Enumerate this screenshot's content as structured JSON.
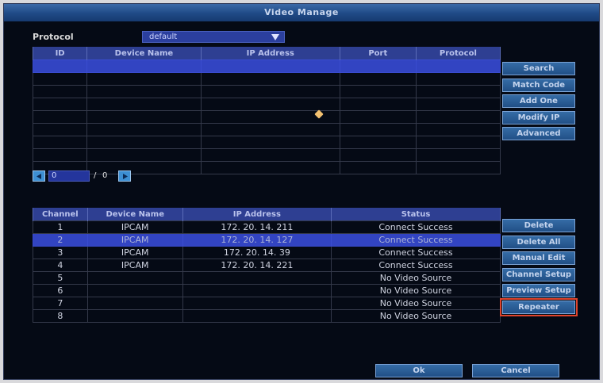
{
  "window": {
    "title": "Video Manage"
  },
  "protocol": {
    "label": "Protocol",
    "value": "default"
  },
  "device_table": {
    "headers": [
      "ID",
      "Device Name",
      "IP Address",
      "Port",
      "Protocol"
    ],
    "row_count": 9,
    "selected_row": 0
  },
  "side_buttons_top": [
    "Search",
    "Match Code",
    "Add One",
    "Modify IP",
    "Advanced"
  ],
  "pager": {
    "current": "0",
    "separator": "/",
    "total": "0"
  },
  "channel_table": {
    "headers": [
      "Channel",
      "Device Name",
      "IP Address",
      "Status"
    ],
    "selected_row": 1,
    "rows": [
      {
        "channel": "1",
        "device": "IPCAM",
        "ip": "172. 20. 14. 211",
        "status": "Connect Success"
      },
      {
        "channel": "2",
        "device": "IPCAM",
        "ip": "172. 20. 14. 127",
        "status": "Connect Success"
      },
      {
        "channel": "3",
        "device": "IPCAM",
        "ip": "172. 20. 14. 39",
        "status": "Connect Success"
      },
      {
        "channel": "4",
        "device": "IPCAM",
        "ip": "172. 20. 14. 221",
        "status": "Connect Success"
      },
      {
        "channel": "5",
        "device": "",
        "ip": "",
        "status": "No Video Source"
      },
      {
        "channel": "6",
        "device": "",
        "ip": "",
        "status": "No Video Source"
      },
      {
        "channel": "7",
        "device": "",
        "ip": "",
        "status": "No Video Source"
      },
      {
        "channel": "8",
        "device": "",
        "ip": "",
        "status": "No Video Source"
      }
    ]
  },
  "side_buttons_bottom": [
    "Delete",
    "Delete All",
    "Manual Edit",
    "Channel Setup",
    "Preview Setup",
    "Repeater"
  ],
  "footer": {
    "ok": "Ok",
    "cancel": "Cancel"
  },
  "colors": {
    "accent": "#3244c2",
    "button": "#2a5c96",
    "highlight_outline": "#e0442c"
  }
}
